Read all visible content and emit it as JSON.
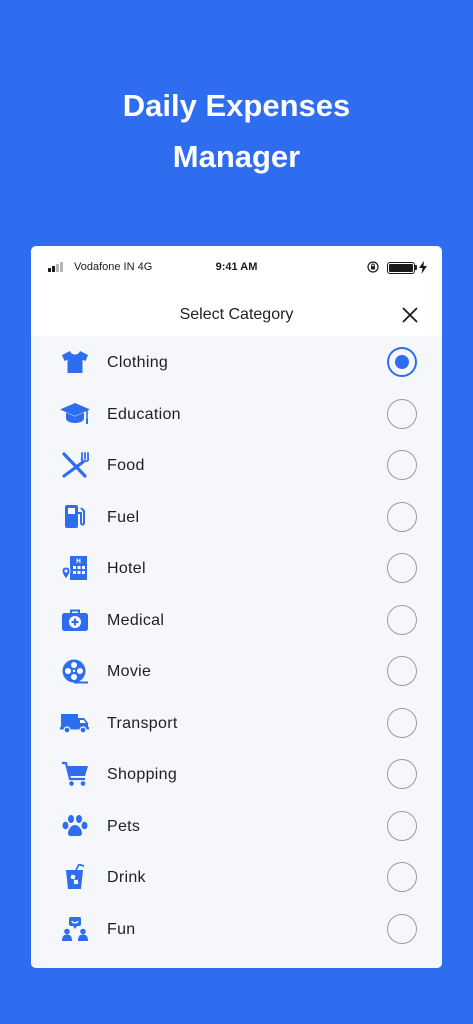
{
  "hero": {
    "line1": "Daily Expenses",
    "line2": "Manager"
  },
  "status_bar": {
    "carrier": "Vodafone IN 4G",
    "time": "9:41 AM"
  },
  "modal": {
    "title": "Select Category"
  },
  "colors": {
    "accent": "#2e6cf0",
    "radio_border": "#9c9c9c",
    "list_bg": "#f6f7fb"
  },
  "categories": [
    {
      "label": "Clothing",
      "icon": "shirt-icon",
      "selected": true
    },
    {
      "label": "Education",
      "icon": "graduation-cap-icon",
      "selected": false
    },
    {
      "label": "Food",
      "icon": "fork-knife-icon",
      "selected": false
    },
    {
      "label": "Fuel",
      "icon": "fuel-pump-icon",
      "selected": false
    },
    {
      "label": "Hotel",
      "icon": "hotel-icon",
      "selected": false
    },
    {
      "label": "Medical",
      "icon": "medical-kit-icon",
      "selected": false
    },
    {
      "label": "Movie",
      "icon": "film-reel-icon",
      "selected": false
    },
    {
      "label": "Transport",
      "icon": "truck-icon",
      "selected": false
    },
    {
      "label": "Shopping",
      "icon": "shopping-cart-icon",
      "selected": false
    },
    {
      "label": "Pets",
      "icon": "paw-icon",
      "selected": false
    },
    {
      "label": "Drink",
      "icon": "drink-cup-icon",
      "selected": false
    },
    {
      "label": "Fun",
      "icon": "fun-people-icon",
      "selected": false
    }
  ]
}
